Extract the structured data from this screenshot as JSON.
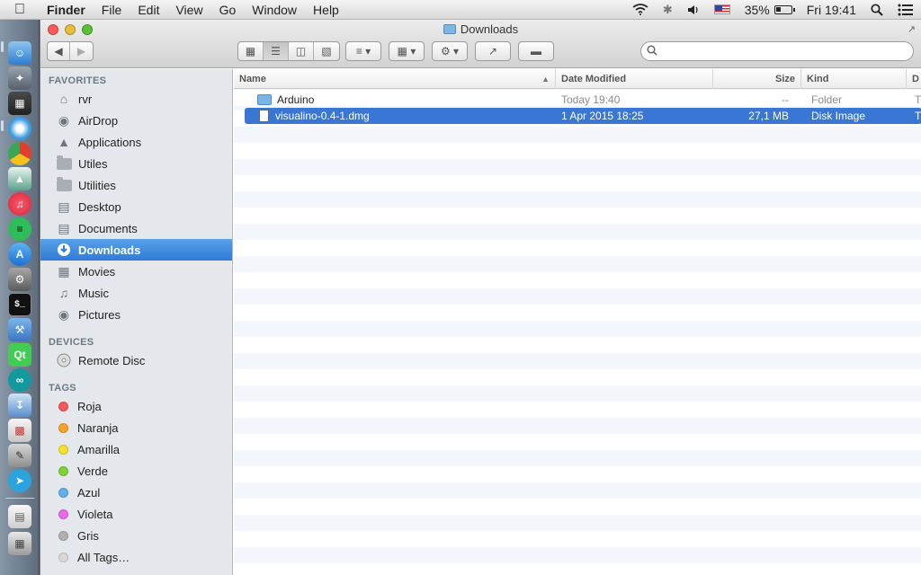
{
  "menubar": {
    "app_name": "Finder",
    "items": [
      "File",
      "Edit",
      "View",
      "Go",
      "Window",
      "Help"
    ],
    "battery": "35%",
    "clock": "Fri 19:41"
  },
  "window": {
    "title": "Downloads",
    "search_placeholder": ""
  },
  "sidebar": {
    "favorites_title": "FAVORITES",
    "favorites": [
      {
        "label": "rvr",
        "icon": "home-icon"
      },
      {
        "label": "AirDrop",
        "icon": "airdrop-icon"
      },
      {
        "label": "Applications",
        "icon": "applications-icon"
      },
      {
        "label": "Utiles",
        "icon": "folder-icon"
      },
      {
        "label": "Utilities",
        "icon": "folder-icon"
      },
      {
        "label": "Desktop",
        "icon": "desktop-icon"
      },
      {
        "label": "Documents",
        "icon": "documents-icon"
      },
      {
        "label": "Downloads",
        "icon": "downloads-icon"
      },
      {
        "label": "Movies",
        "icon": "movies-icon"
      },
      {
        "label": "Music",
        "icon": "music-icon"
      },
      {
        "label": "Pictures",
        "icon": "pictures-icon"
      }
    ],
    "selected": "Downloads",
    "devices_title": "DEVICES",
    "devices": [
      {
        "label": "Remote Disc",
        "icon": "disc-icon"
      }
    ],
    "tags_title": "TAGS",
    "tags": [
      {
        "label": "Roja",
        "color": "#f0585a"
      },
      {
        "label": "Naranja",
        "color": "#f7a12a"
      },
      {
        "label": "Amarilla",
        "color": "#f2e12c"
      },
      {
        "label": "Verde",
        "color": "#7fd13b"
      },
      {
        "label": "Azul",
        "color": "#5fb0ea"
      },
      {
        "label": "Violeta",
        "color": "#e76be8"
      },
      {
        "label": "Gris",
        "color": "#b0b0b0"
      },
      {
        "label": "All Tags…",
        "color": "#d8d8d8"
      }
    ]
  },
  "columns": {
    "name": "Name",
    "date": "Date Modified",
    "size": "Size",
    "kind": "Kind",
    "extra": "D"
  },
  "files": [
    {
      "name": "Arduino",
      "date": "Today 19:40",
      "size": "--",
      "kind": "Folder",
      "extra": "T",
      "type": "folder"
    },
    {
      "name": "visualino-0.4-1.dmg",
      "date": "1 Apr 2015 18:25",
      "size": "27,1 MB",
      "kind": "Disk Image",
      "extra": "T",
      "type": "file"
    }
  ],
  "selected_file": "visualino-0.4-1.dmg",
  "colors": {
    "selection": "#3a76d4",
    "sidebar_selection": "#2f7bd8"
  }
}
